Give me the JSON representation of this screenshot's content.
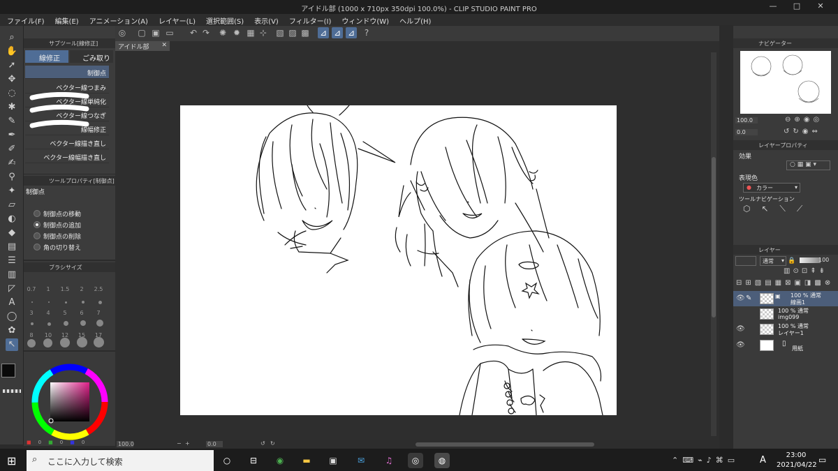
{
  "window": {
    "title": "アイドル部 (1000 x 710px 350dpi 100.0%) - CLIP STUDIO PAINT PRO",
    "minimize": "—",
    "maximize": "□",
    "close": "✕"
  },
  "menu": [
    "ファイル(F)",
    "編集(E)",
    "アニメーション(A)",
    "レイヤー(L)",
    "選択範囲(S)",
    "表示(V)",
    "フィルター(I)",
    "ウィンドウ(W)",
    "ヘルプ(H)"
  ],
  "subtool": {
    "title": "サブツール[線修正]",
    "tabs": [
      "線修正",
      "ごみ取り"
    ],
    "items": [
      "制御点",
      "ベクター線つまみ",
      "ベクター線単純化",
      "ベクター線つなぎ",
      "線幅修正",
      "ベクター線描き直し",
      "ベクター線幅描き直し"
    ]
  },
  "toolprop": {
    "title": "ツールプロパティ[制御点]",
    "name": "制御点",
    "options": [
      "制御点の移動",
      "制御点の追加",
      "制御点の削除",
      "角の切り替え"
    ],
    "selected_index": 1
  },
  "brushsize": {
    "title": "ブラシサイズ",
    "values": [
      "0.7",
      "1",
      "1.5",
      "2",
      "2.5",
      "3",
      "4",
      "5",
      "6",
      "7",
      "8",
      "10",
      "12",
      "15",
      "17"
    ]
  },
  "color": {
    "main": "#0a0a0a",
    "sub": "#f2d0b8",
    "rgb_values": [
      "0",
      "0",
      "0"
    ]
  },
  "document": {
    "tab": "アイドル部",
    "close": "✕"
  },
  "statusbar": {
    "zoom": "100.0",
    "angle": "0.0"
  },
  "navigator": {
    "title": "ナビゲーター",
    "zoom": "100.0",
    "angle": "0.0"
  },
  "layerprop": {
    "title": "レイヤープロパティ",
    "effect_label": "効果",
    "express_label": "表現色",
    "express_value": "カラー",
    "toolnav_label": "ツールナビゲーション"
  },
  "layers": {
    "title": "レイヤー",
    "blend": "通常",
    "opacity": "100",
    "items": [
      {
        "line1": "100 % 通常",
        "line2": "線画1",
        "selected": true
      },
      {
        "line1": "100 % 通常",
        "line2": "img099",
        "selected": false
      },
      {
        "line1": "100 % 通常",
        "line2": "レイヤー1",
        "selected": false
      },
      {
        "line1": "",
        "line2": "用紙",
        "selected": false
      }
    ]
  },
  "taskbar": {
    "search_placeholder": "ここに入力して検索",
    "time": "23:00",
    "date": "2021/04/22",
    "ime": "A"
  }
}
